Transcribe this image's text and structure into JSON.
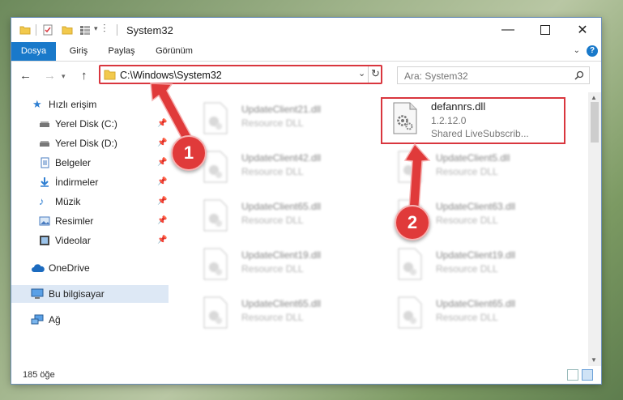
{
  "window": {
    "title": "System32"
  },
  "ribbon": {
    "tabs": [
      "Dosya",
      "Giriş",
      "Paylaş",
      "Görünüm"
    ],
    "help": "?"
  },
  "address": {
    "path": "C:\\Windows\\System32"
  },
  "search": {
    "placeholder": "Ara: System32"
  },
  "sidebar": {
    "items": [
      {
        "label": "Hızlı erişim",
        "icon": "star-icon"
      },
      {
        "label": "Yerel Disk (C:)",
        "icon": "drive-icon",
        "pinned": true
      },
      {
        "label": "Yerel Disk (D:)",
        "icon": "drive-icon",
        "pinned": true
      },
      {
        "label": "Belgeler",
        "icon": "documents-icon",
        "pinned": true
      },
      {
        "label": "İndirmeler",
        "icon": "download-icon",
        "pinned": true
      },
      {
        "label": "Müzik",
        "icon": "music-icon",
        "pinned": true
      },
      {
        "label": "Resimler",
        "icon": "pictures-icon",
        "pinned": true
      },
      {
        "label": "Videolar",
        "icon": "video-icon",
        "pinned": true
      },
      {
        "label": "OneDrive",
        "icon": "cloud-icon"
      },
      {
        "label": "Bu bilgisayar",
        "icon": "computer-icon",
        "selected": true
      },
      {
        "label": "Ağ",
        "icon": "network-icon"
      }
    ]
  },
  "files": {
    "left": [
      {
        "name": "UpdateClient21.dll",
        "type": "Resource DLL"
      },
      {
        "name": "UpdateClient42.dll",
        "type": "Resource DLL"
      },
      {
        "name": "UpdateClient65.dll",
        "type": "Resource DLL"
      },
      {
        "name": "UpdateClient19.dll",
        "type": "Resource DLL"
      },
      {
        "name": "UpdateClient65.dll",
        "type": "Resource DLL"
      }
    ],
    "right": [
      {
        "name": "defannrs.dll",
        "version": "1.2.12.0",
        "desc": "Shared LiveSubscrib..."
      },
      {
        "name": "UpdateClient5.dll",
        "type": "Resource DLL"
      },
      {
        "name": "UpdateClient63.dll",
        "type": "Resource DLL"
      },
      {
        "name": "UpdateClient19.dll",
        "type": "Resource DLL"
      },
      {
        "name": "UpdateClient65.dll",
        "type": "Resource DLL"
      }
    ]
  },
  "status": {
    "count": "185 öğe"
  },
  "callouts": {
    "one": "1",
    "two": "2"
  },
  "colors": {
    "accent": "#1979ca",
    "highlight": "#d9363e",
    "selected": "#dde8f5"
  }
}
